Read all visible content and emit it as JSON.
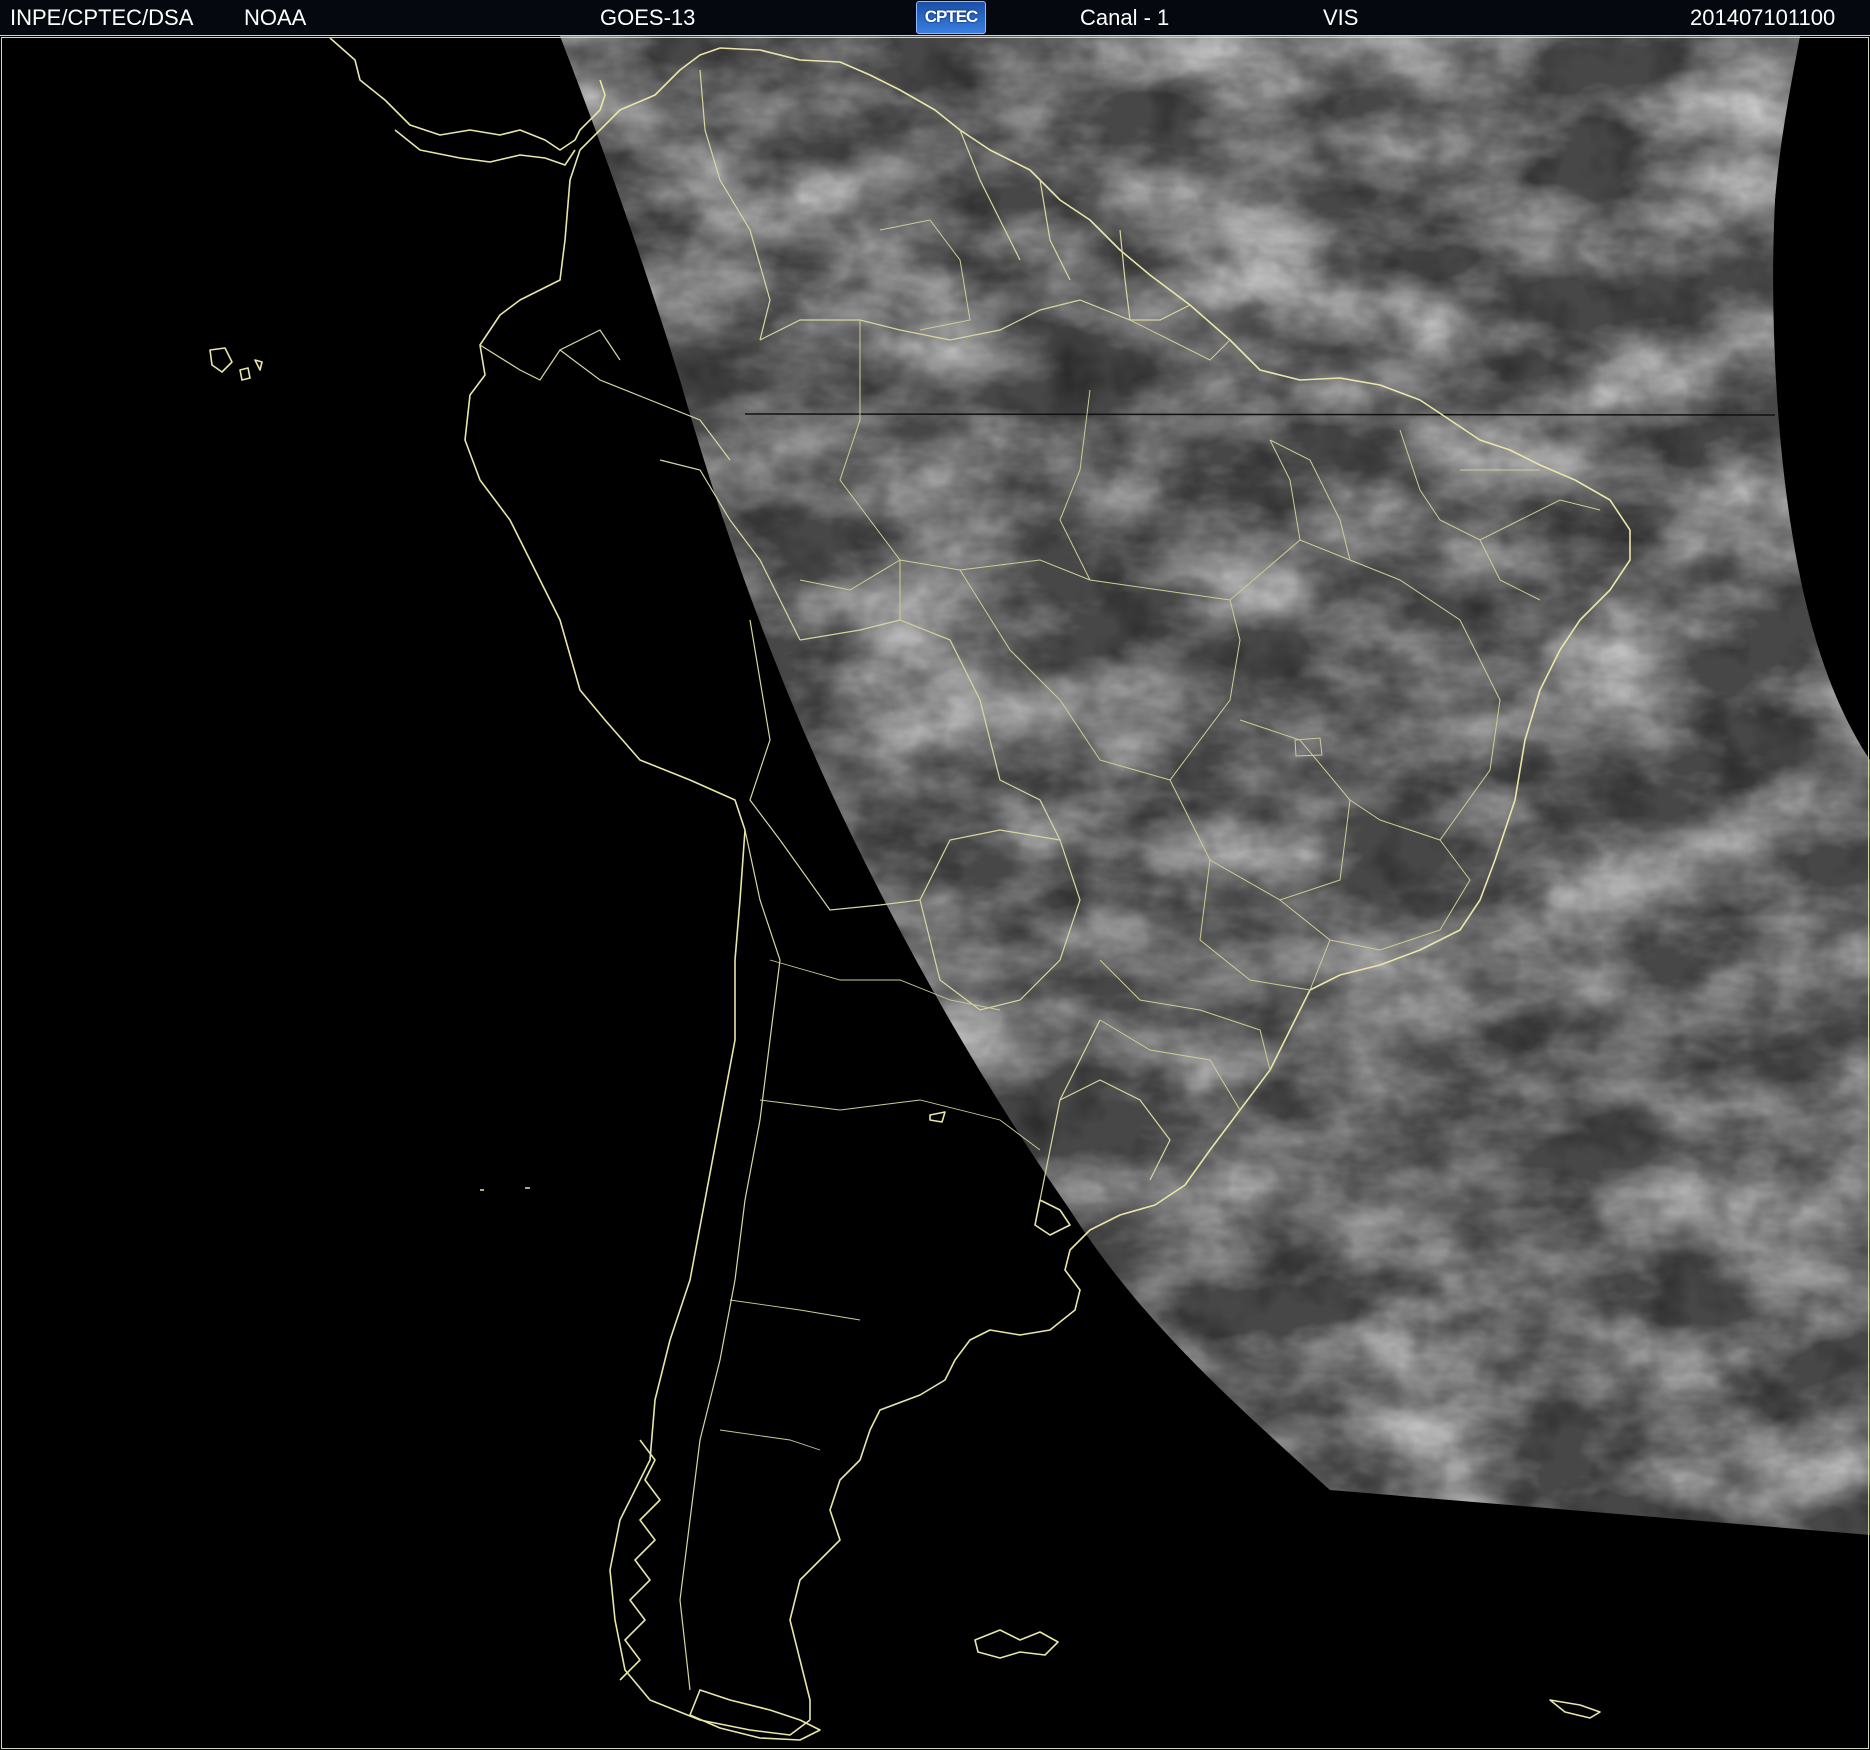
{
  "header": {
    "org": "INPE/CPTEC/DSA",
    "agency": "NOAA",
    "satellite": "GOES-13",
    "logo": "CPTEC",
    "channel": "Canal - 1",
    "band": "VIS",
    "timestamp": "201407101100"
  },
  "colors": {
    "background": "#000000",
    "coastline": "#e8e6a8",
    "cloud_base": "#4a4a4a",
    "header_text": "#ffffff"
  }
}
